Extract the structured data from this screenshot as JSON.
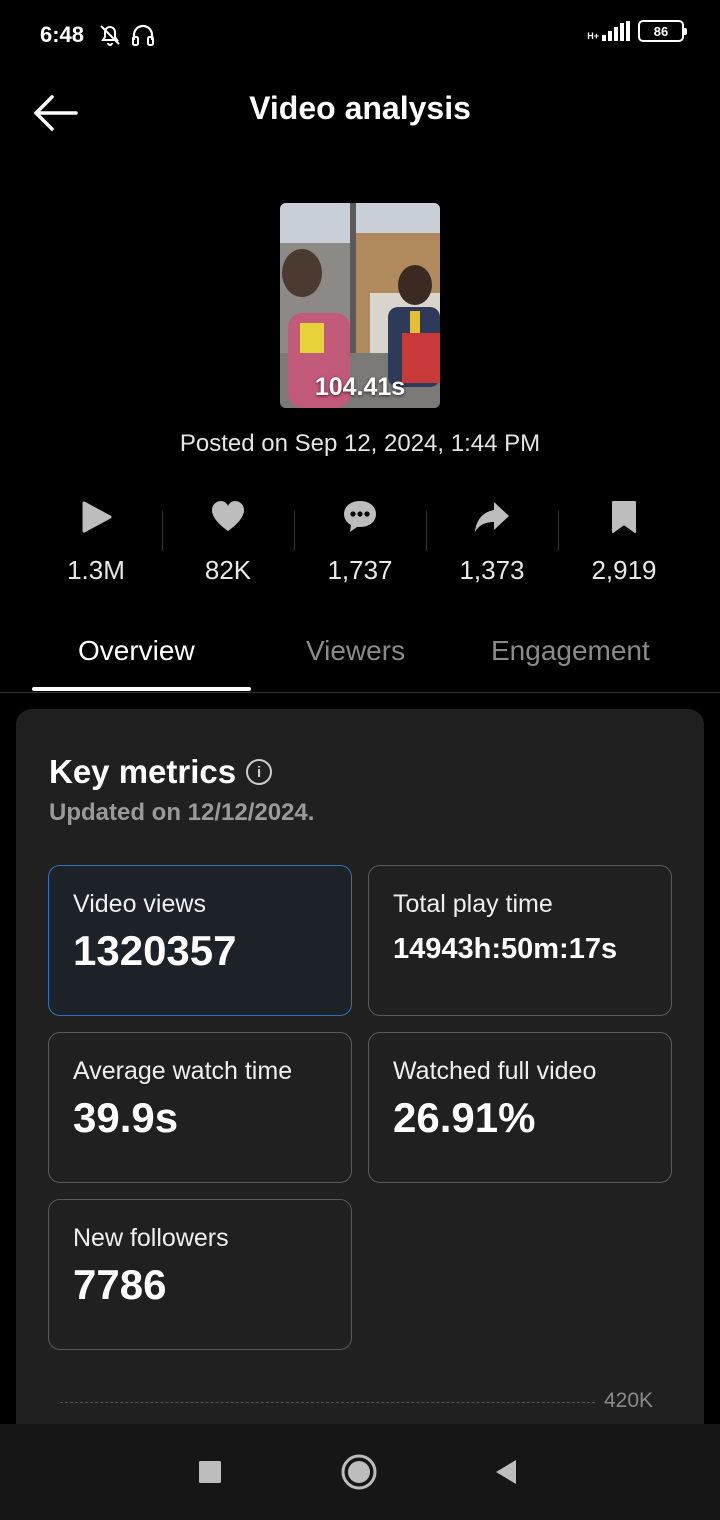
{
  "status": {
    "time": "6:48",
    "network": "H+",
    "battery": "86"
  },
  "header": {
    "title": "Video analysis"
  },
  "video": {
    "duration": "104.41s",
    "posted": "Posted on Sep 12, 2024, 1:44 PM"
  },
  "stats": [
    {
      "icon": "play-icon",
      "value": "1.3M"
    },
    {
      "icon": "heart-icon",
      "value": "82K"
    },
    {
      "icon": "comment-icon",
      "value": "1,737"
    },
    {
      "icon": "share-icon",
      "value": "1,373"
    },
    {
      "icon": "bookmark-icon",
      "value": "2,919"
    }
  ],
  "tabs": [
    {
      "label": "Overview",
      "active": true
    },
    {
      "label": "Viewers",
      "active": false
    },
    {
      "label": "Engagement",
      "active": false
    }
  ],
  "key_metrics": {
    "title": "Key metrics",
    "updated": "Updated on 12/12/2024.",
    "items": [
      {
        "label": "Video views",
        "value": "1320357"
      },
      {
        "label": "Total play time",
        "value": "14943h:50m:17s"
      },
      {
        "label": "Average watch time",
        "value": "39.9s"
      },
      {
        "label": "Watched full video",
        "value": "26.91%"
      },
      {
        "label": "New followers",
        "value": "7786"
      }
    ],
    "chart_tick": "420K"
  },
  "colors": {
    "background": "#000000",
    "card": "#202020",
    "selected_border": "#2f72c0"
  }
}
